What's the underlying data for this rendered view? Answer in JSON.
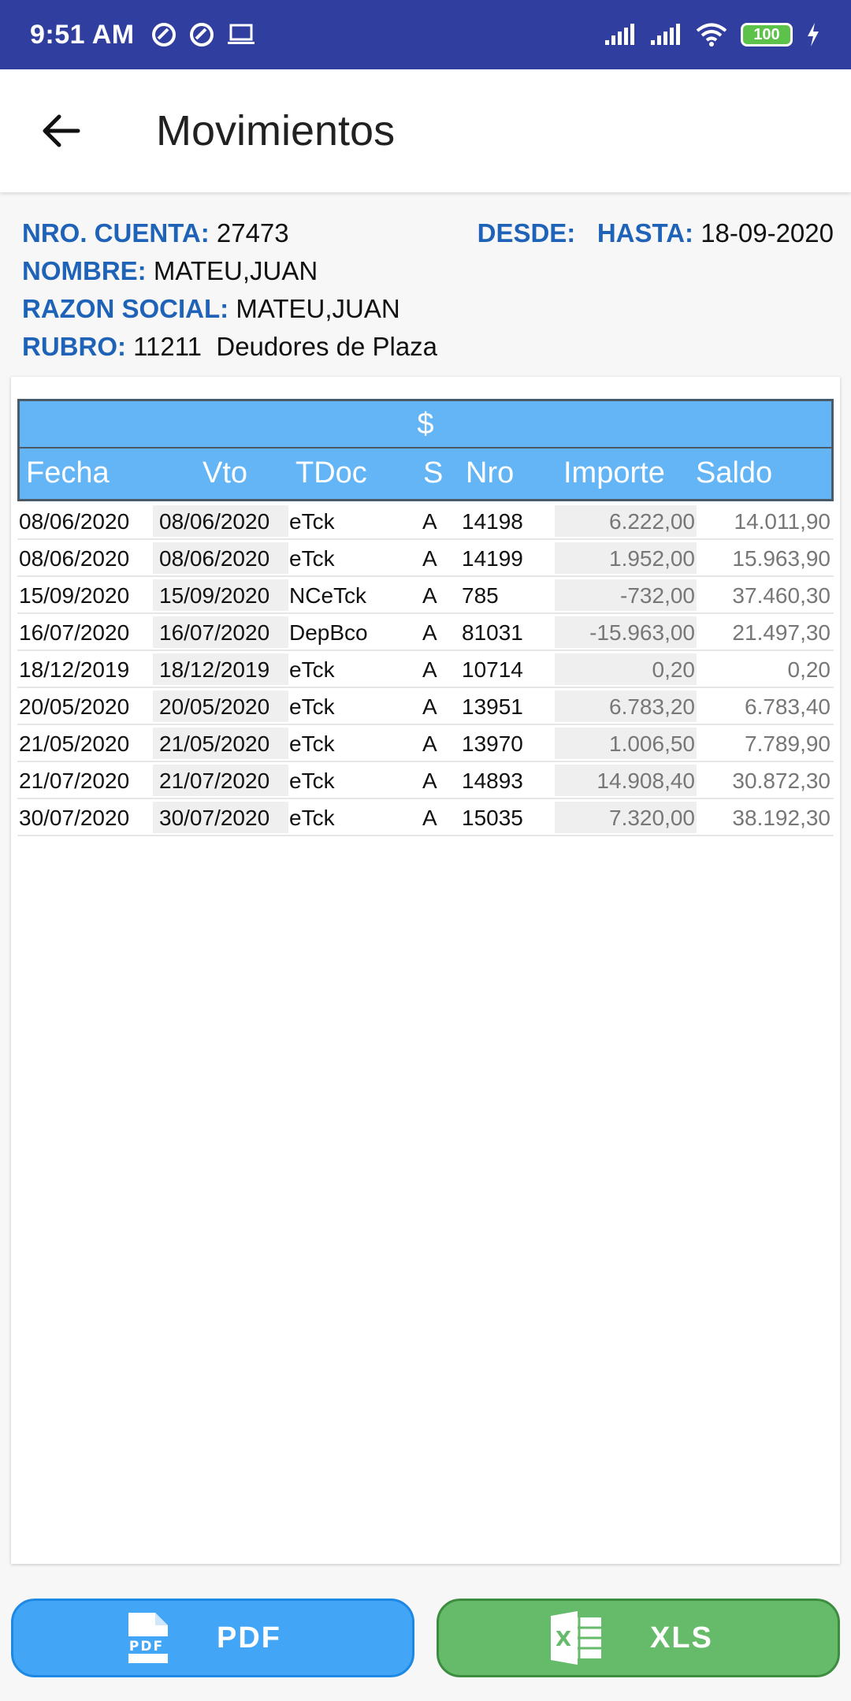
{
  "status": {
    "time": "9:51 AM",
    "battery": "100"
  },
  "appbar": {
    "title": "Movimientos"
  },
  "account": {
    "nro_label": "NRO. CUENTA:",
    "nro_value": "27473",
    "desde_label": "DESDE:",
    "hasta_label": "HASTA:",
    "hasta_value": "18-09-2020",
    "nombre_label": "NOMBRE:",
    "nombre_value": "MATEU,JUAN",
    "razon_label": "RAZON SOCIAL:",
    "razon_value": "MATEU,JUAN",
    "rubro_label": "RUBRO:",
    "rubro_value": "11211  Deudores de Plaza"
  },
  "table": {
    "currency": "$",
    "headers": [
      "Fecha",
      "Vto",
      "TDoc",
      "S",
      "Nro",
      "Importe",
      "Saldo"
    ],
    "rows": [
      [
        "08/06/2020",
        "08/06/2020",
        "eTck",
        "A",
        "14198",
        "6.222,00",
        "14.011,90"
      ],
      [
        "08/06/2020",
        "08/06/2020",
        "eTck",
        "A",
        "14199",
        "1.952,00",
        "15.963,90"
      ],
      [
        "15/09/2020",
        "15/09/2020",
        "NCeTck",
        "A",
        "785",
        "-732,00",
        "37.460,30"
      ],
      [
        "16/07/2020",
        "16/07/2020",
        "DepBco",
        "A",
        "81031",
        "-15.963,00",
        "21.497,30"
      ],
      [
        "18/12/2019",
        "18/12/2019",
        "eTck",
        "A",
        "10714",
        "0,20",
        "0,20"
      ],
      [
        "20/05/2020",
        "20/05/2020",
        "eTck",
        "A",
        "13951",
        "6.783,20",
        "6.783,40"
      ],
      [
        "21/05/2020",
        "21/05/2020",
        "eTck",
        "A",
        "13970",
        "1.006,50",
        "7.789,90"
      ],
      [
        "21/07/2020",
        "21/07/2020",
        "eTck",
        "A",
        "14893",
        "14.908,40",
        "30.872,30"
      ],
      [
        "30/07/2020",
        "30/07/2020",
        "eTck",
        "A",
        "15035",
        "7.320,00",
        "38.192,30"
      ]
    ]
  },
  "buttons": {
    "pdf_label": "PDF",
    "xls_label": "XLS"
  },
  "icons": {
    "back": "arrow-left-icon",
    "pdf": "pdf-file-icon",
    "xls": "excel-file-icon"
  },
  "colors": {
    "status_bar": "#303f9f",
    "header_blue": "#64b5f6",
    "label_blue": "#1e63b8",
    "pdf_btn": "#42a5f5",
    "xls_btn": "#66bb6a"
  }
}
